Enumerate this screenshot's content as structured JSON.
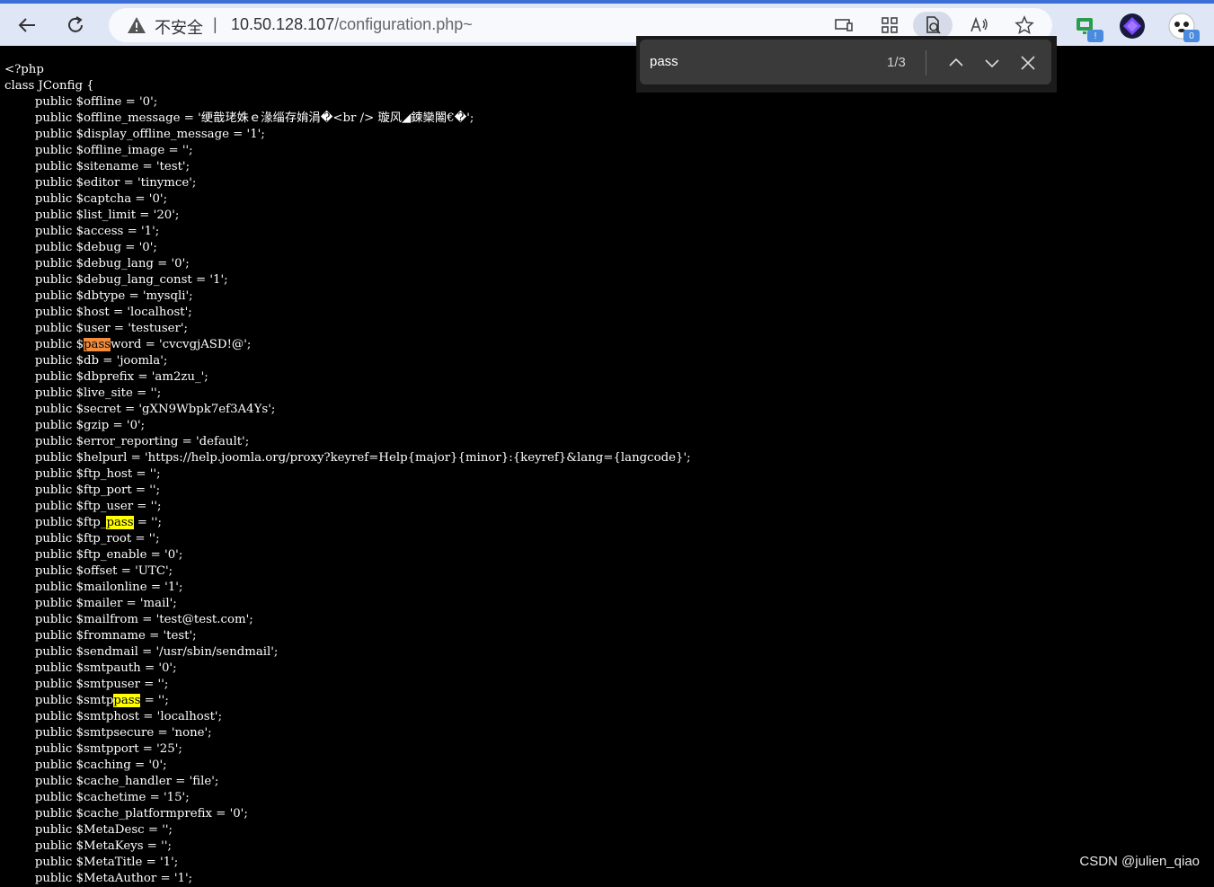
{
  "browser": {
    "security_label": "不安全",
    "separator": "|",
    "url_host": "10.50.128.107",
    "url_path": "/configuration.php~",
    "extension_badges": [
      "!",
      "0"
    ]
  },
  "find_bar": {
    "query": "pass",
    "match_count": "1/3"
  },
  "code_lines": [
    "<?php",
    "class JConfig {",
    "        public $offline = '0';",
    "        public $offline_message = '绠戠珯姝ｅ湪缁存姢涓�<br /> 璇风◢鍊欒闂€�';",
    "        public $display_offline_message = '1';",
    "        public $offline_image = '';",
    "        public $sitename = 'test';",
    "        public $editor = 'tinymce';",
    "        public $captcha = '0';",
    "        public $list_limit = '20';",
    "        public $access = '1';",
    "        public $debug = '0';",
    "        public $debug_lang = '0';",
    "        public $debug_lang_const = '1';",
    "        public $dbtype = 'mysqli';",
    "        public $host = 'localhost';",
    "        public $user = 'testuser';",
    "        public $password = 'cvcvgjASD!@';",
    "        public $db = 'joomla';",
    "        public $dbprefix = 'am2zu_';",
    "        public $live_site = '';",
    "        public $secret = 'gXN9Wbpk7ef3A4Ys';",
    "        public $gzip = '0';",
    "        public $error_reporting = 'default';",
    "        public $helpurl = 'https://help.joomla.org/proxy?keyref=Help{major}{minor}:{keyref}&lang={langcode}';",
    "        public $ftp_host = '';",
    "        public $ftp_port = '';",
    "        public $ftp_user = '';",
    "        public $ftp_pass = '';",
    "        public $ftp_root = '';",
    "        public $ftp_enable = '0';",
    "        public $offset = 'UTC';",
    "        public $mailonline = '1';",
    "        public $mailer = 'mail';",
    "        public $mailfrom = 'test@test.com';",
    "        public $fromname = 'test';",
    "        public $sendmail = '/usr/sbin/sendmail';",
    "        public $smtpauth = '0';",
    "        public $smtpuser = '';",
    "        public $smtppass = '';",
    "        public $smtphost = 'localhost';",
    "        public $smtpsecure = 'none';",
    "        public $smtpport = '25';",
    "        public $caching = '0';",
    "        public $cache_handler = 'file';",
    "        public $cachetime = '15';",
    "        public $cache_platformprefix = '0';",
    "        public $MetaDesc = '';",
    "        public $MetaKeys = '';",
    "        public $MetaTitle = '1';",
    "        public $MetaAuthor = '1';"
  ],
  "highlights": {
    "current_line": 17,
    "other_lines": [
      28,
      39
    ]
  },
  "watermark": "CSDN @julien_qiao"
}
